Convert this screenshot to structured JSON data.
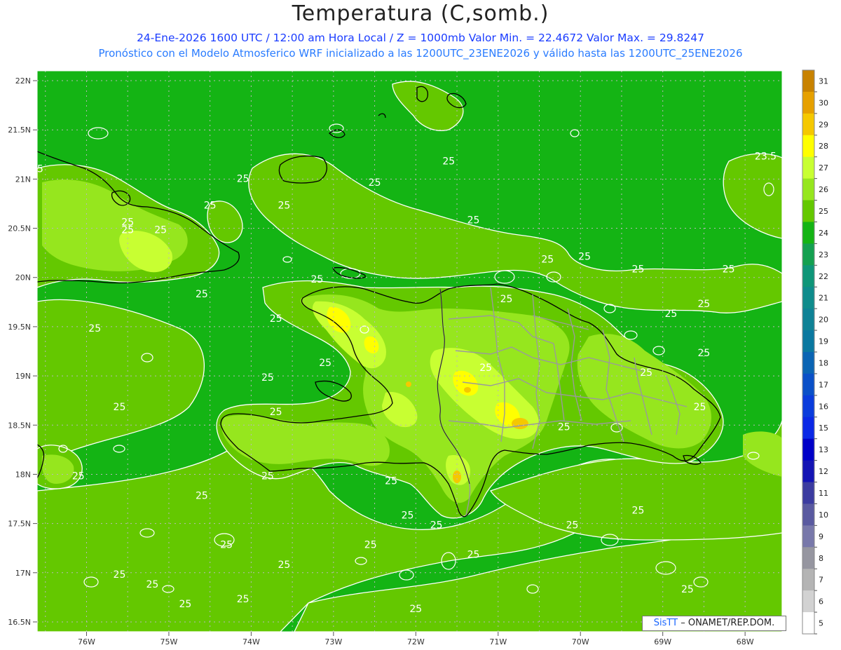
{
  "header": {
    "title": "Temperatura (C,somb.)",
    "line1": "24-Ene-2026 1600 UTC / 12:00 am Hora Local / Z = 1000mb  Valor Min. = 22.4672  Valor Max. = 29.8247",
    "line2": "Pronóstico con el Modelo Atmosferico WRF inicializado a las 1200UTC_23ENE2026 y válido hasta las  1200UTC_25ENE2026"
  },
  "axes": {
    "lat_ticks": [
      "22N",
      "21.5N",
      "21N",
      "20.5N",
      "20N",
      "19.5N",
      "19N",
      "18.5N",
      "18N",
      "17.5N",
      "17N",
      "16.5N"
    ],
    "lon_ticks": [
      "76W",
      "75W",
      "74W",
      "73W",
      "72W",
      "71W",
      "70W",
      "69W",
      "68W"
    ]
  },
  "colorbar": {
    "labels": [
      "31",
      "30",
      "29",
      "28",
      "27",
      "26",
      "25",
      "24",
      "23",
      "22",
      "21",
      "20",
      "19",
      "18",
      "17",
      "16",
      "15",
      "13",
      "12",
      "11",
      "10",
      "9",
      "8",
      "7",
      "6",
      "5"
    ],
    "colors": [
      "#c88200",
      "#e6a000",
      "#f5c800",
      "#ffff00",
      "#c8ff32",
      "#96e61e",
      "#64c800",
      "#14b414",
      "#14a050",
      "#0f9678",
      "#0f8c8c",
      "#0f8296",
      "#0a78a0",
      "#0a64b4",
      "#0a50c8",
      "#0a3cdc",
      "#0a28e6",
      "#0000c8",
      "#1414b4",
      "#3c3ca0",
      "#5a5aa0",
      "#7878aa",
      "#9696a0",
      "#b4b4b4",
      "#d2d2d2",
      "#ffffff"
    ]
  },
  "contour_labels": [
    {
      "text": "25",
      "lon": -76.6,
      "lat": 21.07
    },
    {
      "text": "25",
      "lon": -74.1,
      "lat": 20.97
    },
    {
      "text": "25",
      "lon": -73.6,
      "lat": 20.7
    },
    {
      "text": "25",
      "lon": -72.5,
      "lat": 20.93
    },
    {
      "text": "25",
      "lon": -71.6,
      "lat": 21.15
    },
    {
      "text": "25",
      "lon": -71.3,
      "lat": 20.55
    },
    {
      "text": "25",
      "lon": -75.5,
      "lat": 20.53
    },
    {
      "text": "25",
      "lon": -75.5,
      "lat": 20.45
    },
    {
      "text": "25",
      "lon": -75.1,
      "lat": 20.45
    },
    {
      "text": "25",
      "lon": -74.5,
      "lat": 20.7
    },
    {
      "text": "25",
      "lon": -74.6,
      "lat": 19.8
    },
    {
      "text": "25",
      "lon": -75.9,
      "lat": 19.45
    },
    {
      "text": "25",
      "lon": -73.7,
      "lat": 19.55
    },
    {
      "text": "25",
      "lon": -73.2,
      "lat": 19.95
    },
    {
      "text": "25",
      "lon": -73.8,
      "lat": 18.95
    },
    {
      "text": "25",
      "lon": -73.7,
      "lat": 18.6
    },
    {
      "text": "25",
      "lon": -73.1,
      "lat": 19.1
    },
    {
      "text": "25",
      "lon": -75.6,
      "lat": 18.65
    },
    {
      "text": "25",
      "lon": -76.1,
      "lat": 17.95
    },
    {
      "text": "25",
      "lon": -74.6,
      "lat": 17.75
    },
    {
      "text": "25",
      "lon": -73.8,
      "lat": 17.95
    },
    {
      "text": "25",
      "lon": -72.3,
      "lat": 17.9
    },
    {
      "text": "25",
      "lon": -72.1,
      "lat": 17.55
    },
    {
      "text": "25",
      "lon": -71.75,
      "lat": 17.45
    },
    {
      "text": "25",
      "lon": -70.9,
      "lat": 19.75
    },
    {
      "text": "25",
      "lon": -70.4,
      "lat": 20.15
    },
    {
      "text": "25",
      "lon": -69.95,
      "lat": 20.18
    },
    {
      "text": "25",
      "lon": -69.3,
      "lat": 20.05
    },
    {
      "text": "25",
      "lon": -68.2,
      "lat": 20.05
    },
    {
      "text": "25",
      "lon": -68.9,
      "lat": 19.6
    },
    {
      "text": "25",
      "lon": -68.5,
      "lat": 19.7
    },
    {
      "text": "25",
      "lon": -68.5,
      "lat": 19.2
    },
    {
      "text": "25",
      "lon": -69.2,
      "lat": 19.0
    },
    {
      "text": "25",
      "lon": -68.55,
      "lat": 18.65
    },
    {
      "text": "25",
      "lon": -70.2,
      "lat": 18.45
    },
    {
      "text": "25",
      "lon": -71.15,
      "lat": 19.05
    },
    {
      "text": "25",
      "lon": -74.3,
      "lat": 17.25
    },
    {
      "text": "25",
      "lon": -73.6,
      "lat": 17.05
    },
    {
      "text": "25",
      "lon": -72.55,
      "lat": 17.25
    },
    {
      "text": "25",
      "lon": -71.3,
      "lat": 17.15
    },
    {
      "text": "25",
      "lon": -70.1,
      "lat": 17.45
    },
    {
      "text": "25",
      "lon": -69.3,
      "lat": 17.6
    },
    {
      "text": "25",
      "lon": -68.7,
      "lat": 16.8
    },
    {
      "text": "25",
      "lon": -75.6,
      "lat": 16.95
    },
    {
      "text": "25",
      "lon": -75.2,
      "lat": 16.85
    },
    {
      "text": "25",
      "lon": -74.8,
      "lat": 16.65
    },
    {
      "text": "25",
      "lon": -74.1,
      "lat": 16.7
    },
    {
      "text": "25",
      "lon": -72.0,
      "lat": 16.6
    },
    {
      "text": "23.5",
      "lon": -67.75,
      "lat": 21.2
    }
  ],
  "credit": {
    "brand": "SisTT",
    "org": "– ONAMET/REP.DOM."
  }
}
